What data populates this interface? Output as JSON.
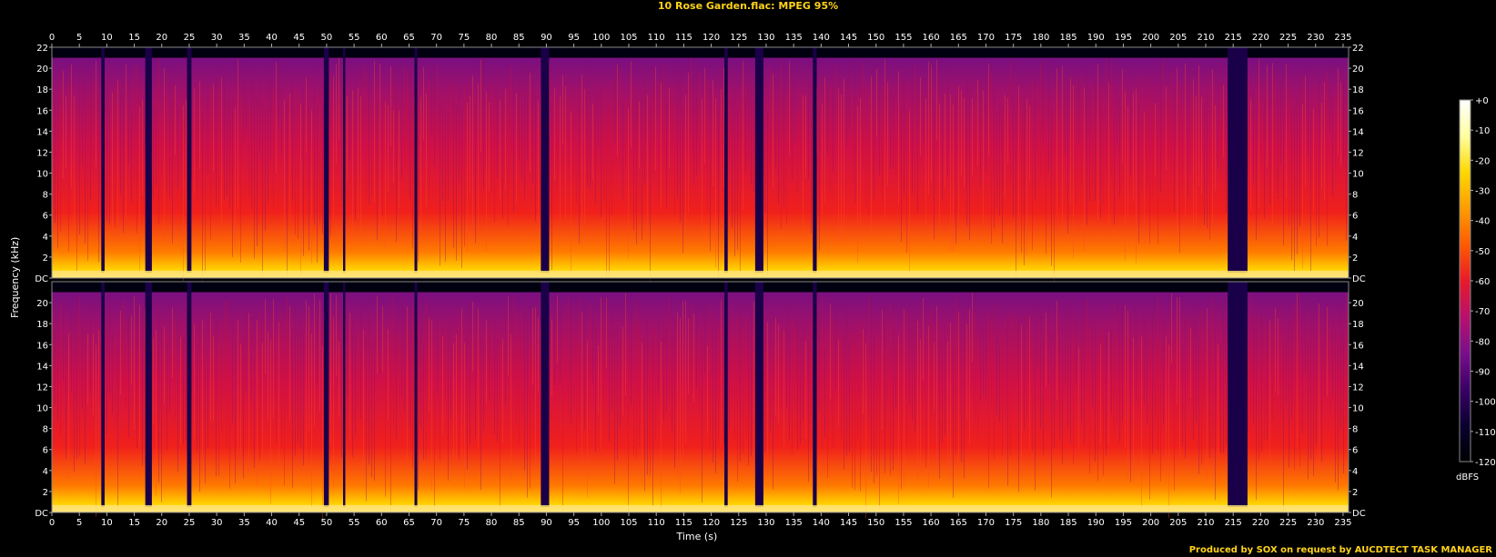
{
  "title": "10 Rose Garden.flac: MPEG 95%",
  "credit": "Produced by SOX on request by AUCDTECT TASK MANAGER",
  "colors": {
    "background": "#000000",
    "text": "#ffffff",
    "title": "#ffd21a"
  },
  "chart_data": {
    "type": "heatmap",
    "xlabel": "Time (s)",
    "ylabel": "Frequency (kHz)",
    "x_ticks": [
      "0",
      "5",
      "10",
      "15",
      "20",
      "25",
      "30",
      "35",
      "40",
      "45",
      "50",
      "55",
      "60",
      "65",
      "70",
      "75",
      "80",
      "85",
      "90",
      "95",
      "100",
      "105",
      "110",
      "115",
      "120",
      "125",
      "130",
      "135",
      "140",
      "145",
      "150",
      "155",
      "160",
      "165",
      "170",
      "175",
      "180",
      "185",
      "190",
      "195",
      "200",
      "205",
      "210",
      "215",
      "220",
      "225",
      "230",
      "235"
    ],
    "y_ticks": [
      "DC",
      "2",
      "4",
      "6",
      "8",
      "10",
      "12",
      "14",
      "16",
      "18",
      "20",
      "22"
    ],
    "xlim": [
      0,
      236
    ],
    "ylim": [
      0,
      22
    ],
    "channels": 2,
    "lowpass_cutoff_khz": 21,
    "colorbar": {
      "label": "dBFS",
      "ticks": [
        "+0",
        "-10",
        "-20",
        "-30",
        "-40",
        "-50",
        "-60",
        "-70",
        "-80",
        "-90",
        "-100",
        "-110",
        "-120"
      ],
      "range": [
        -120,
        0
      ],
      "colormap": [
        "#000000",
        "#0a0030",
        "#3a0066",
        "#7a0f8a",
        "#b8106e",
        "#e81a2a",
        "#ff5a00",
        "#ff9c00",
        "#ffd800",
        "#ffffa0",
        "#ffffff"
      ]
    },
    "quiet_gaps_s": [
      [
        9,
        9.6
      ],
      [
        17,
        18.2
      ],
      [
        24.6,
        25.4
      ],
      [
        49.5,
        50.4
      ],
      [
        53,
        53.4
      ],
      [
        66,
        66.5
      ],
      [
        89,
        90.5
      ],
      [
        122.4,
        123
      ],
      [
        128,
        129.5
      ],
      [
        138.5,
        139.2
      ],
      [
        214,
        217.6
      ]
    ]
  }
}
